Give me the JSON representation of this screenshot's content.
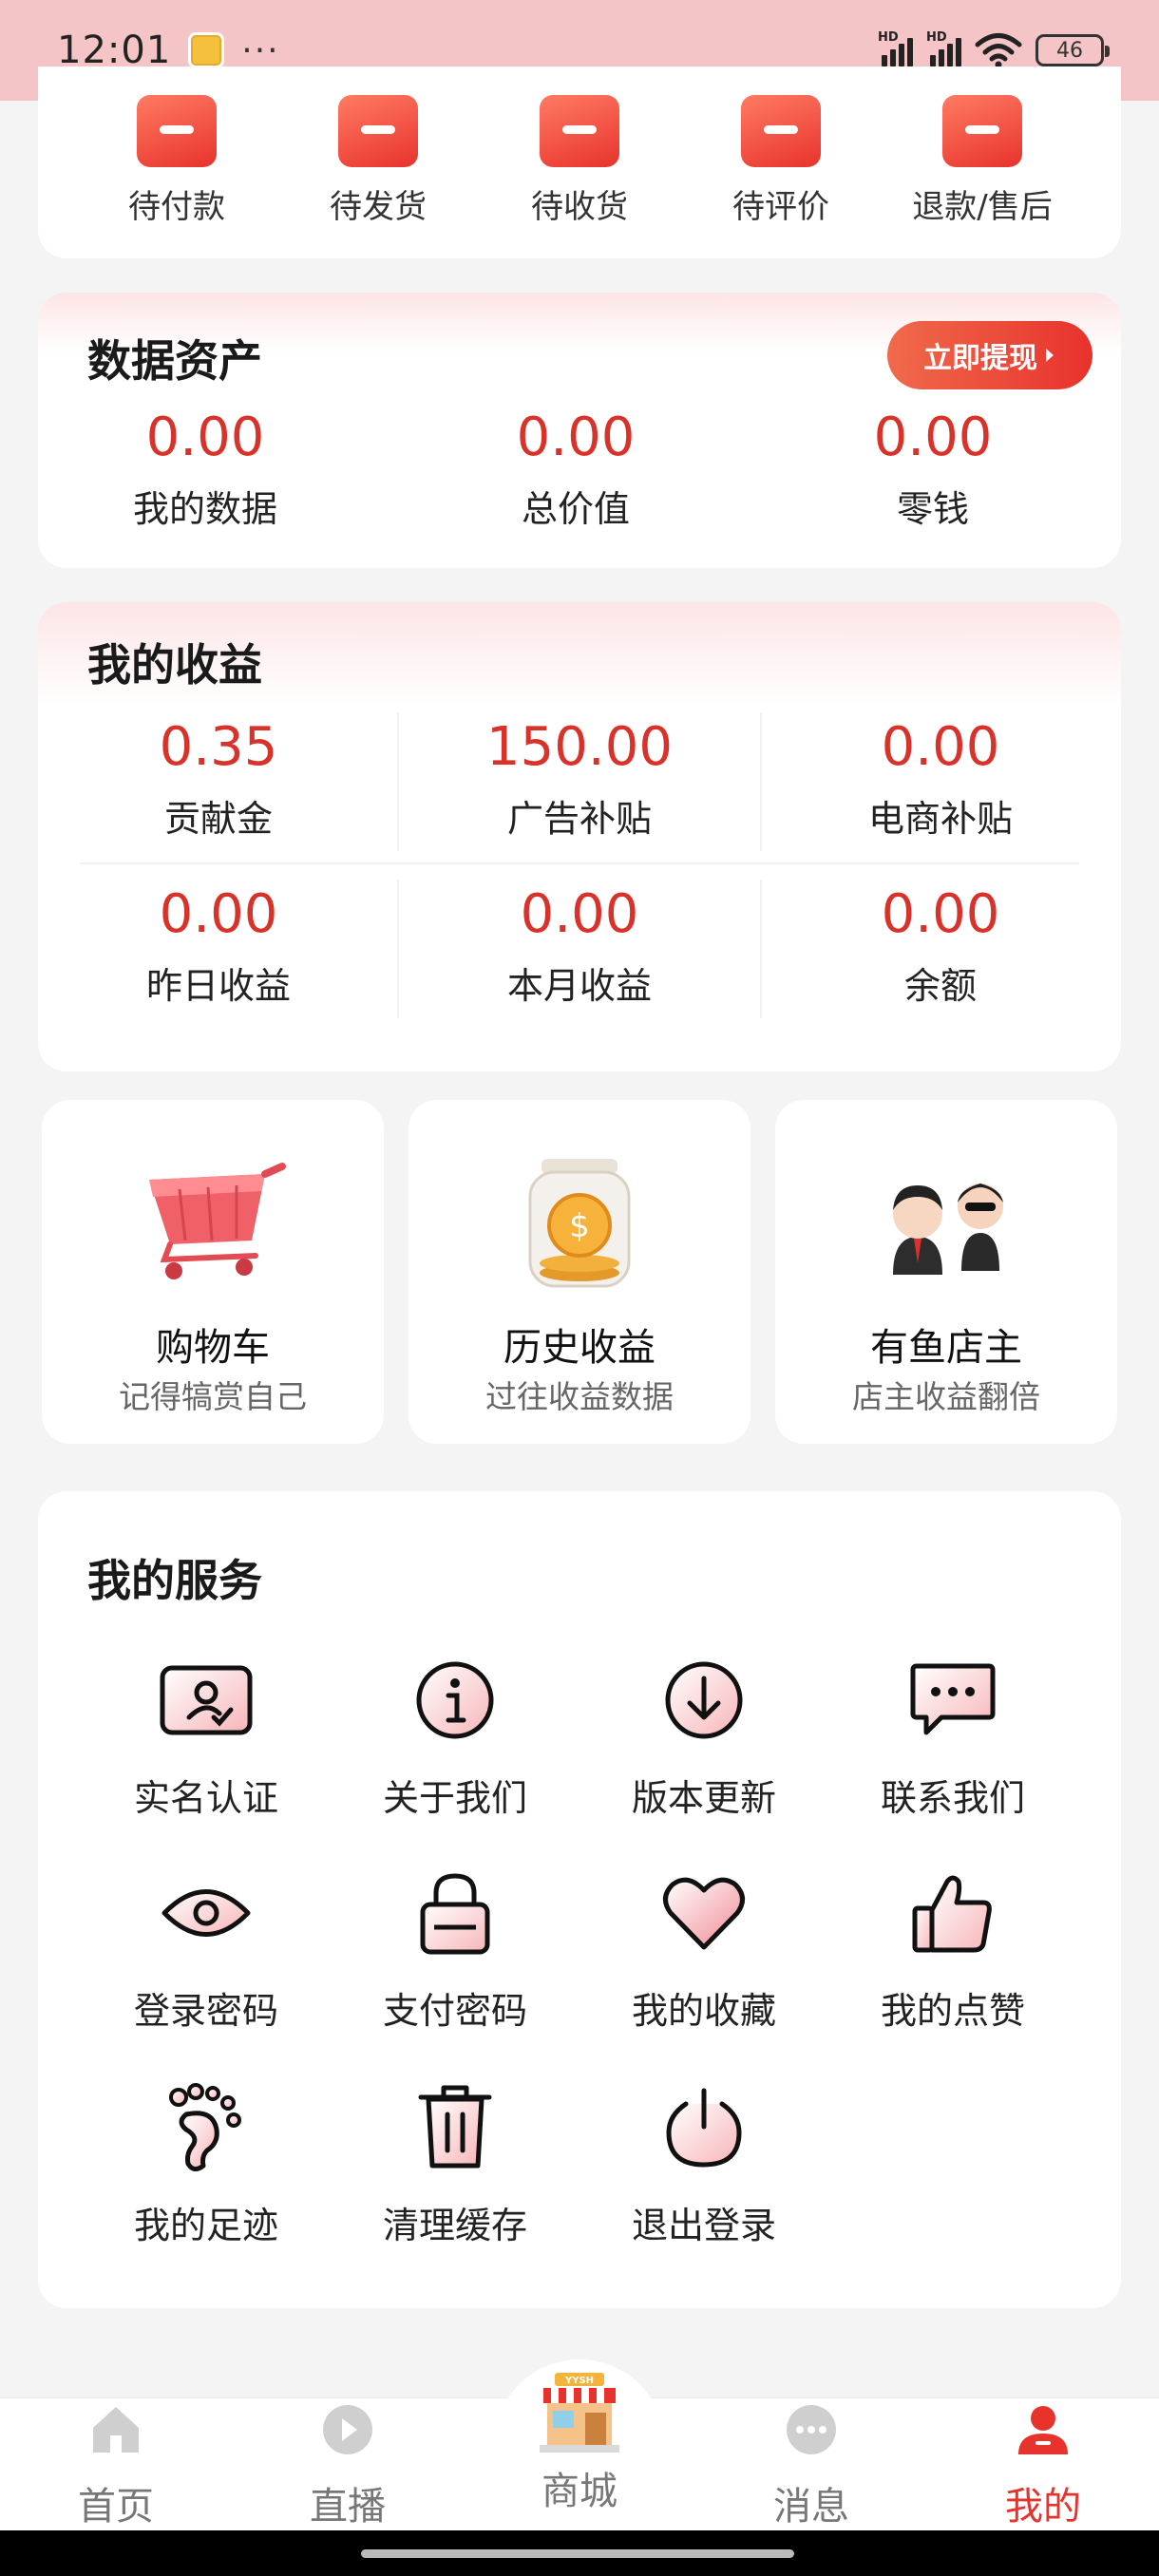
{
  "status_bar": {
    "time": "12:01",
    "dots": "···",
    "battery": "46",
    "hd": "HD"
  },
  "orders": [
    "待付款",
    "待发货",
    "待收货",
    "待评价",
    "退款/售后"
  ],
  "assets": {
    "title": "数据资产",
    "withdraw_label": "立即提现",
    "items": [
      {
        "value": "0.00",
        "label": "我的数据"
      },
      {
        "value": "0.00",
        "label": "总价值"
      },
      {
        "value": "0.00",
        "label": "零钱"
      }
    ]
  },
  "income": {
    "title": "我的收益",
    "items": [
      {
        "value": "0.35",
        "label": "贡献金"
      },
      {
        "value": "150.00",
        "label": "广告补贴"
      },
      {
        "value": "0.00",
        "label": "电商补贴"
      },
      {
        "value": "0.00",
        "label": "昨日收益"
      },
      {
        "value": "0.00",
        "label": "本月收益"
      },
      {
        "value": "0.00",
        "label": "余额"
      }
    ]
  },
  "tiles": [
    {
      "title": "购物车",
      "subtitle": "记得犒赏自己",
      "icon": "shopping-cart"
    },
    {
      "title": "历史收益",
      "subtitle": "过往收益数据",
      "icon": "coin-jar"
    },
    {
      "title": "有鱼店主",
      "subtitle": "店主收益翻倍",
      "icon": "shop-owners"
    }
  ],
  "services": {
    "title": "我的服务",
    "items": [
      {
        "label": "实名认证",
        "icon": "id-card-icon"
      },
      {
        "label": "关于我们",
        "icon": "info-icon"
      },
      {
        "label": "版本更新",
        "icon": "download-icon"
      },
      {
        "label": "联系我们",
        "icon": "chat-icon"
      },
      {
        "label": "登录密码",
        "icon": "eye-icon"
      },
      {
        "label": "支付密码",
        "icon": "lock-icon"
      },
      {
        "label": "我的收藏",
        "icon": "heart-icon"
      },
      {
        "label": "我的点赞",
        "icon": "thumbs-up-icon"
      },
      {
        "label": "我的足迹",
        "icon": "footprint-icon"
      },
      {
        "label": "清理缓存",
        "icon": "trash-icon"
      },
      {
        "label": "退出登录",
        "icon": "power-icon"
      }
    ]
  },
  "nav": {
    "items": [
      {
        "label": "首页",
        "icon": "home-icon"
      },
      {
        "label": "直播",
        "icon": "play-icon"
      },
      {
        "label": "商城",
        "icon": "store-icon"
      },
      {
        "label": "消息",
        "icon": "message-icon"
      },
      {
        "label": "我的",
        "icon": "profile-icon"
      }
    ],
    "active": "我的",
    "store_sign": "YYSH"
  },
  "colors": {
    "accent": "#e8322c",
    "value_red": "#d8322a",
    "status_bar": "#f5c4c7",
    "background": "#f4f4f4"
  }
}
